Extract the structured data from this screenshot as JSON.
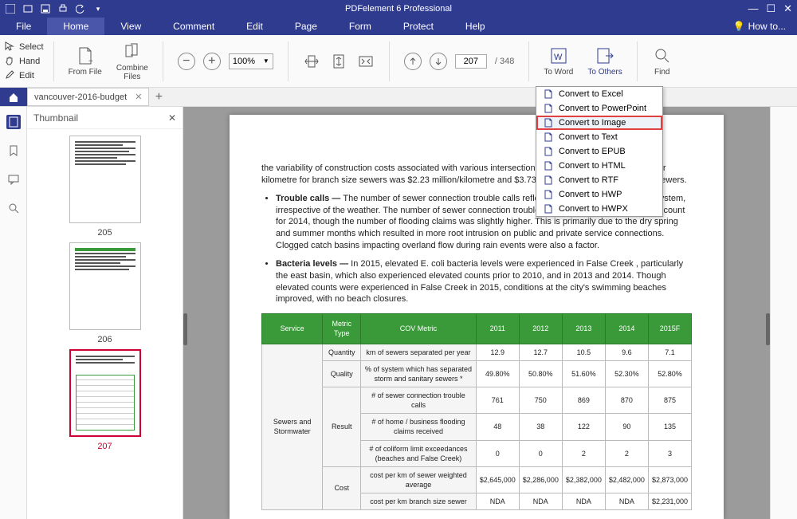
{
  "app": {
    "title": "PDFelement 6 Professional"
  },
  "menubar": {
    "items": [
      "File",
      "Home",
      "View",
      "Comment",
      "Edit",
      "Page",
      "Form",
      "Protect",
      "Help"
    ],
    "howto": "How to..."
  },
  "ribbon": {
    "select": "Select",
    "hand": "Hand",
    "edit": "Edit",
    "from_file": "From File",
    "combine": "Combine\nFiles",
    "zoom": "100%",
    "page_current": "207",
    "page_total": "/   348",
    "to_word": "To Word",
    "to_others": "To Others",
    "find": "Find"
  },
  "tab": {
    "name": "vancouver-2016-budget"
  },
  "thumb": {
    "title": "Thumbnail",
    "labels": [
      "205",
      "206",
      "207"
    ]
  },
  "dropdown": {
    "items": [
      "Convert to Excel",
      "Convert to PowerPoint",
      "Convert to Image",
      "Convert to Text",
      "Convert to EPUB",
      "Convert to HTML",
      "Convert to RTF",
      "Convert to HWP",
      "Convert to HWPX"
    ],
    "highlighted": 2
  },
  "doc": {
    "para1": "the variability of construction costs associated with various intersection geometries. In 2015, the cost per kilometre for branch size sewers was $2.23 million/kilometre and $3.73 million/kilometre for trunk size sewers.",
    "b2_t": "Trouble calls — ",
    "b2": "The number of sewer connection trouble calls reflects the condition of the sewer system, irrespective of the weather. The number of sewer connection trouble calls in 2015 was similar to the count for 2014, though the number of flooding claims was slightly higher. This is primarily due to the dry spring and summer months which resulted in more root intrusion on public and private service connections. Clogged catch basins impacting overland flow during rain events were also a factor.",
    "b3_t": "Bacteria levels — ",
    "b3": "In 2015, elevated E. coli bacteria levels were experienced in False Creek , particularly the east basin, which also experienced elevated counts prior to 2010, and in 2013 and 2014. Though elevated counts were experienced in False Creek in 2015, conditions at the city's swimming beaches improved, with no beach closures."
  },
  "chart_data": {
    "type": "table",
    "headers": [
      "Service",
      "Metric Type",
      "COV Metric",
      "2011",
      "2012",
      "2013",
      "2014",
      "2015F"
    ],
    "service": "Sewers and Stormwater",
    "rows": [
      {
        "metric_type": "Quantity",
        "cov": "km of sewers separated per year",
        "v": [
          "12.9",
          "12.7",
          "10.5",
          "9.6",
          "7.1"
        ]
      },
      {
        "metric_type": "Quality",
        "cov": "% of system which has separated storm and sanitary sewers *",
        "v": [
          "49.80%",
          "50.80%",
          "51.60%",
          "52.30%",
          "52.80%"
        ]
      },
      {
        "metric_type": "Result",
        "cov": "# of sewer connection trouble calls",
        "v": [
          "761",
          "750",
          "869",
          "870",
          "875"
        ]
      },
      {
        "metric_type": "",
        "cov": "# of home / business flooding claims received",
        "v": [
          "48",
          "38",
          "122",
          "90",
          "135"
        ]
      },
      {
        "metric_type": "",
        "cov": "# of coliform limit exceedances (beaches and False Creek)",
        "v": [
          "0",
          "0",
          "2",
          "2",
          "3"
        ]
      },
      {
        "metric_type": "Cost",
        "cov": "cost per km of sewer weighted average",
        "v": [
          "$2,645,000",
          "$2,286,000",
          "$2,382,000",
          "$2,482,000",
          "$2,873,000"
        ]
      },
      {
        "metric_type": "",
        "cov": "cost per km branch size sewer",
        "v": [
          "NDA",
          "NDA",
          "NDA",
          "NDA",
          "$2,231,000"
        ]
      }
    ]
  }
}
